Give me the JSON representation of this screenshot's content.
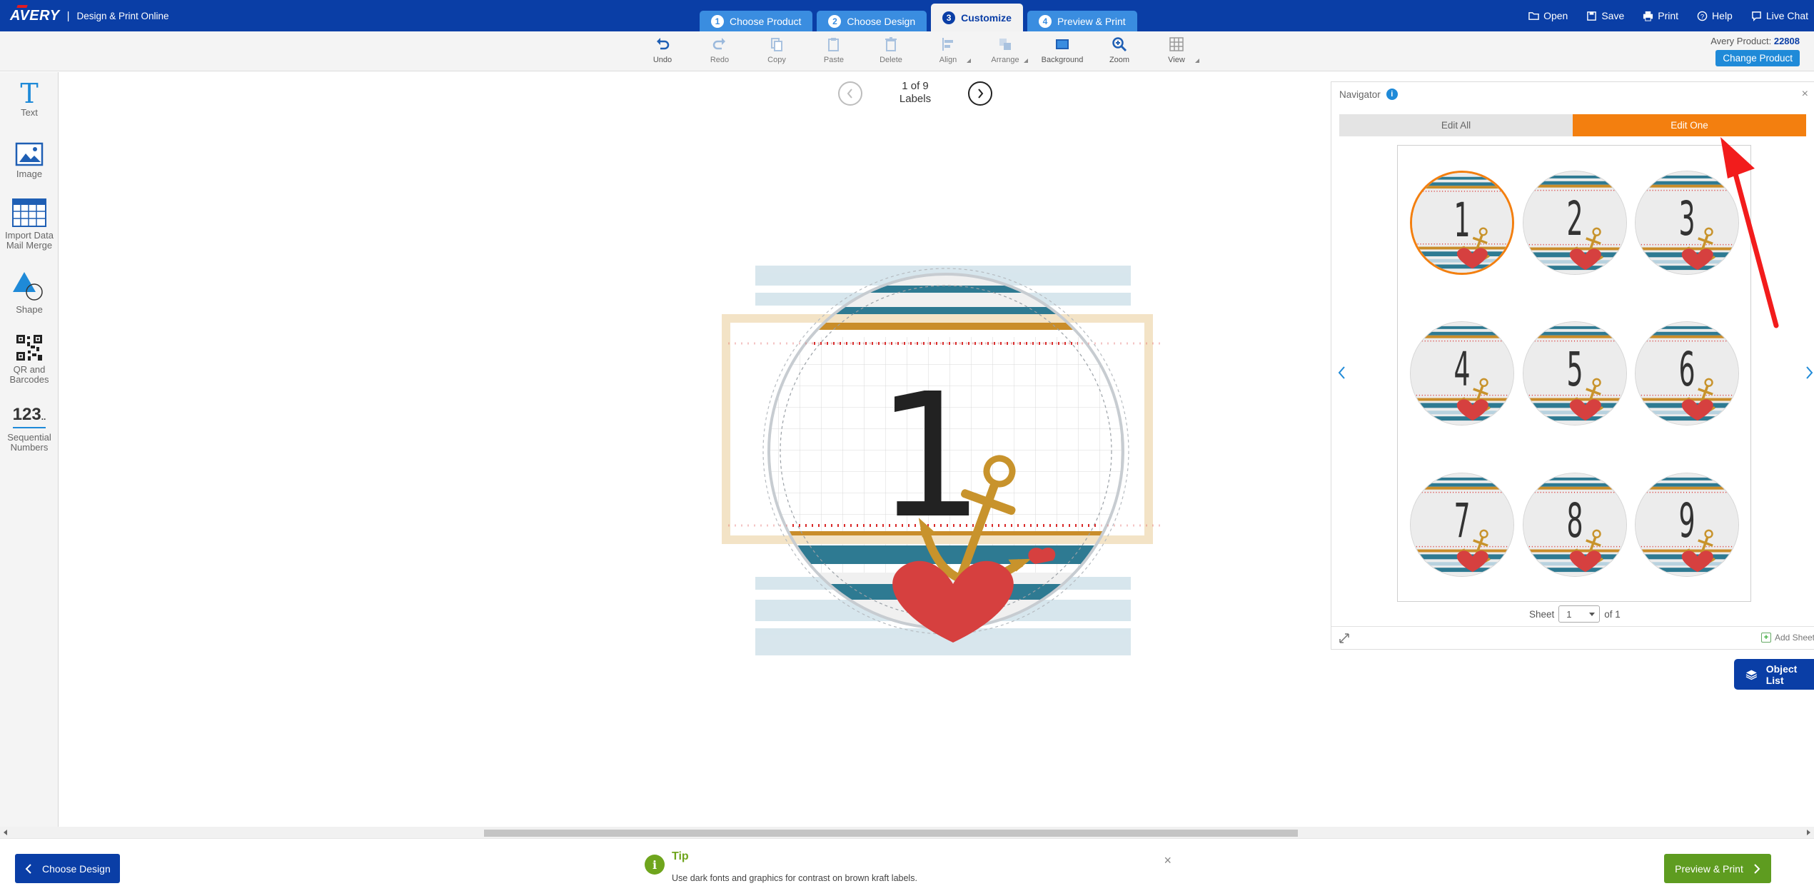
{
  "app": {
    "brand": "AVERY",
    "separator": "|",
    "name": "Design & Print Online"
  },
  "steps": [
    {
      "num": "1",
      "label": "Choose Product"
    },
    {
      "num": "2",
      "label": "Choose Design"
    },
    {
      "num": "3",
      "label": "Customize"
    },
    {
      "num": "4",
      "label": "Preview & Print"
    }
  ],
  "top_actions": {
    "open": "Open",
    "save": "Save",
    "print": "Print",
    "help": "Help",
    "live_chat": "Live Chat"
  },
  "toolbar": {
    "undo": "Undo",
    "redo": "Redo",
    "copy": "Copy",
    "paste": "Paste",
    "delete": "Delete",
    "align": "Align",
    "arrange": "Arrange",
    "background": "Background",
    "zoom": "Zoom",
    "view": "View"
  },
  "product": {
    "label": "Avery Product:",
    "number": "22808",
    "change": "Change Product"
  },
  "left_panel": {
    "text": "Text",
    "image": "Image",
    "import_1": "Import Data",
    "import_2": "Mail Merge",
    "shape": "Shape",
    "qr_1": "QR and",
    "qr_2": "Barcodes",
    "seq_glyph": "123",
    "seq_1": "Sequential",
    "seq_2": "Numbers"
  },
  "pager": {
    "line1": "1 of 9",
    "line2": "Labels"
  },
  "navigator": {
    "title": "Navigator",
    "info": "i",
    "close": "×",
    "edit_all": "Edit All",
    "edit_one": "Edit One",
    "labels": [
      "1",
      "2",
      "3",
      "4",
      "5",
      "6",
      "7",
      "8",
      "9"
    ],
    "sheet_label": "Sheet",
    "sheet_value": "1",
    "sheet_of": "of 1",
    "add_sheet": "Add Sheet"
  },
  "label_design": {
    "number": "1"
  },
  "object_list": "Object List",
  "bottom": {
    "back": "Choose Design",
    "tip_title": "Tip",
    "tip_text": "Use dark fonts and graphics for contrast on brown kraft labels.",
    "preview": "Preview & Print"
  },
  "colors": {
    "brand_blue": "#0a3ea6",
    "step_blue": "#3a8de0",
    "accent_orange": "#f37f0f",
    "tip_green": "#6fa51d",
    "preview_green": "#5e9c20",
    "arrow_red": "#f21c1c"
  }
}
